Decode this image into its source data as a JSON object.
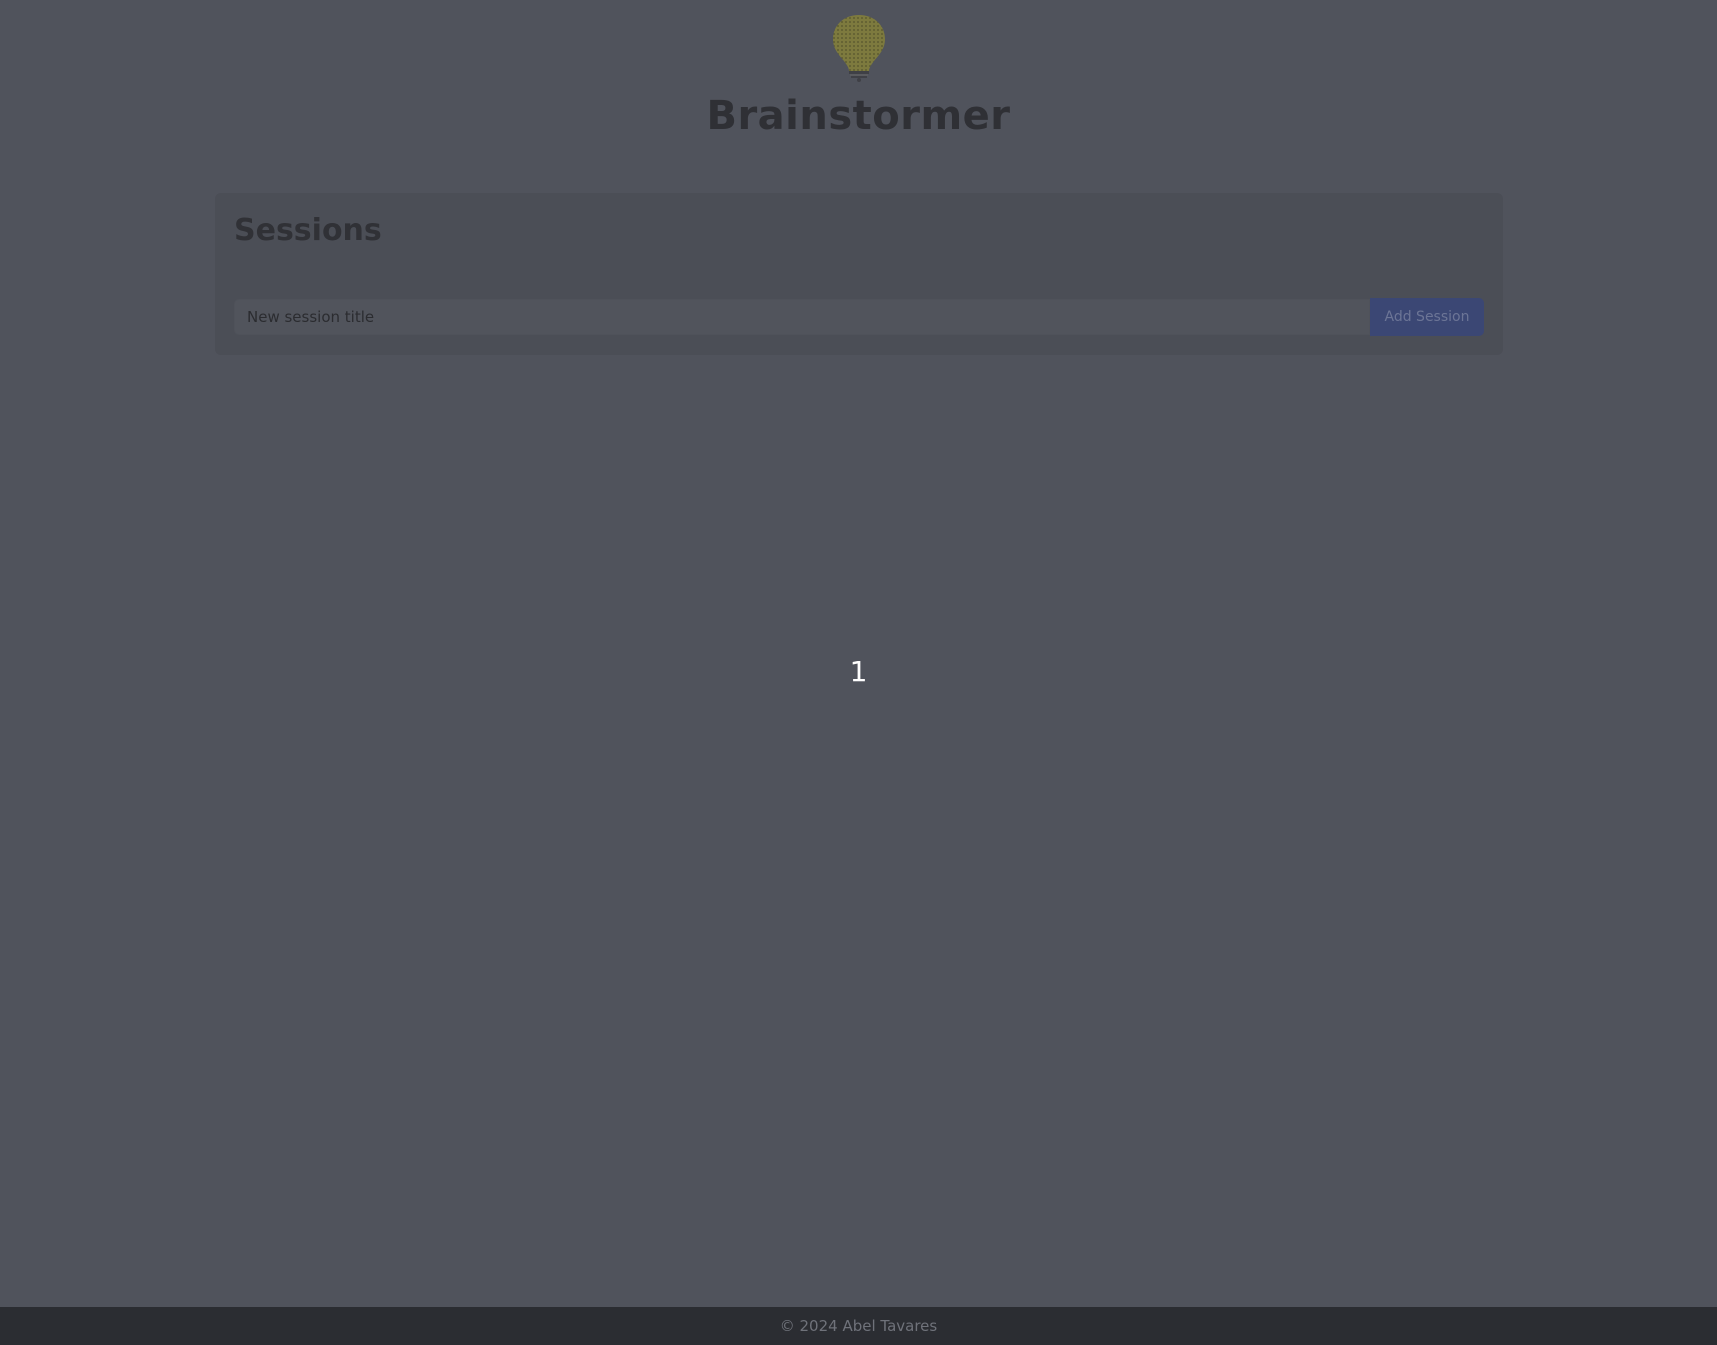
{
  "app": {
    "title": "Brainstormer",
    "logo_icon": "lightbulb-icon"
  },
  "sessions": {
    "heading": "Sessions",
    "input_placeholder": "New session title",
    "input_value": "",
    "add_button_label": "Add Session"
  },
  "pagination": {
    "current_page": "1"
  },
  "footer": {
    "text": "© 2024 Abel Tavares"
  },
  "colors": {
    "background": "#50535c",
    "panel": "#4b4e56",
    "primary_button": "#3b4774",
    "logo_bulb": "#7d7a3e",
    "footer": "#2b2d32"
  }
}
